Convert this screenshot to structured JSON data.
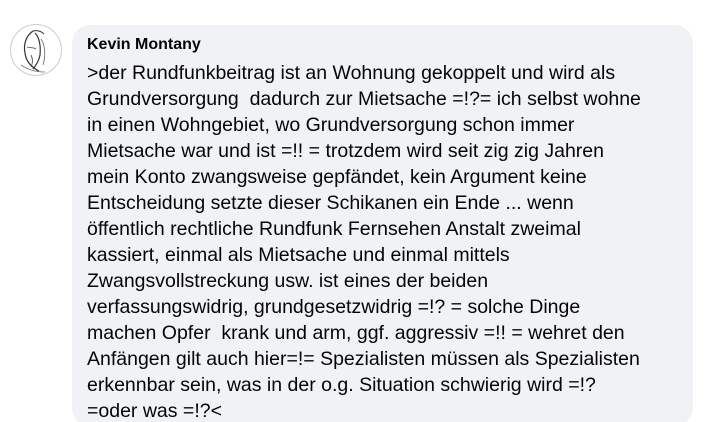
{
  "comment": {
    "author": "Kevin Montany",
    "lines": [
      ">der Rundfunkbeitrag ist an Wohnung gekoppelt und wird als",
      "Grundversorgung  dadurch zur Mietsache =!?= ich selbst wohne",
      "in einen Wohngebiet, wo Grundversorgung schon immer",
      "Mietsache war und ist =!! = trotzdem wird seit zig zig Jahren",
      "mein Konto zwangsweise gepfändet, kein Argument keine",
      "Entscheidung setzte dieser Schikanen ein Ende ... wenn",
      "öffentlich rechtliche Rundfunk Fernsehen Anstalt zweimal",
      "kassiert, einmal als Mietsache und einmal mittels",
      "Zwangsvollstreckung usw. ist eines der beiden",
      "verfassungswidrig, grundgesetzwidrig =!? = solche Dinge",
      "machen Opfer  krank und arm, ggf. aggressiv =!! = wehret den",
      "Anfängen gilt auch hier=!= Spezialisten müssen als Spezialisten",
      "erkennbar sein, was in der o.g. Situation schwierig wird =!?",
      "=oder was =!?<"
    ]
  },
  "colors": {
    "bubble_background": "#f0f2f5",
    "text": "#050505",
    "avatar_border": "#c9ccd1"
  },
  "icons": {
    "avatar": "sketched-face-avatar-icon"
  }
}
